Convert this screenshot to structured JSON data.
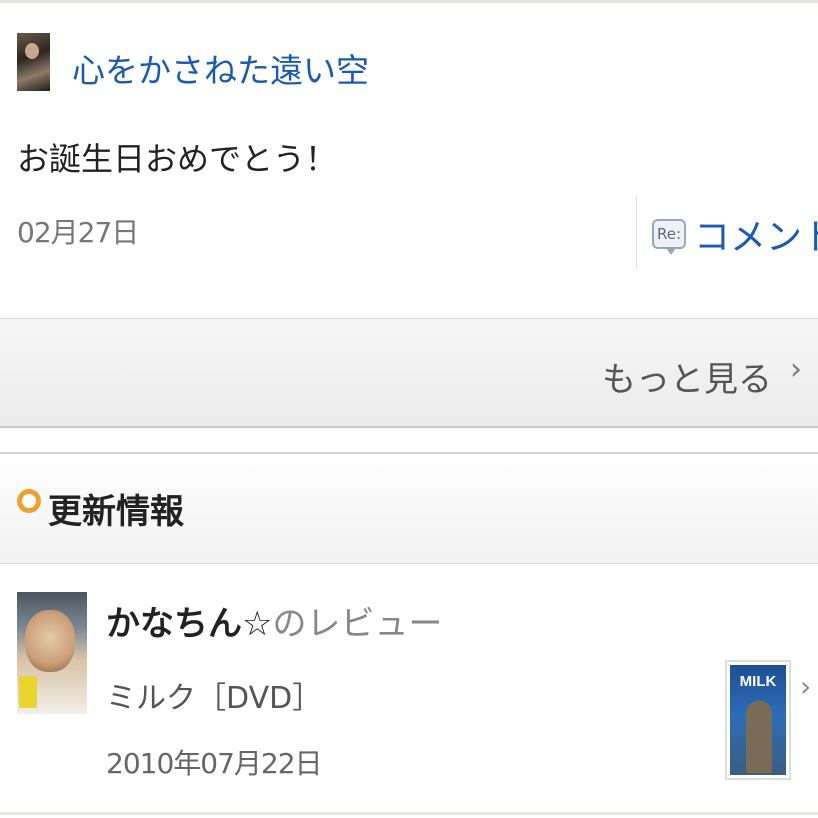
{
  "comment_card": {
    "author": "心をかさねた遠い空",
    "message": "お誕生日おめでとう！",
    "date": "02月27日",
    "comment_icon_label": "Re:",
    "comment_button": "コメント"
  },
  "more": {
    "label": "もっと見る",
    "chevron": "›"
  },
  "updates": {
    "title": "更新情報",
    "item": {
      "reviewer": "かなちん☆",
      "suffix": "のレビュー",
      "product": "ミルク［DVD］",
      "date": "2010年07月22日",
      "cover_title": "MILK",
      "chevron": "›"
    }
  },
  "colors": {
    "link": "#1a5bb0",
    "bullet": "#f0a030"
  }
}
